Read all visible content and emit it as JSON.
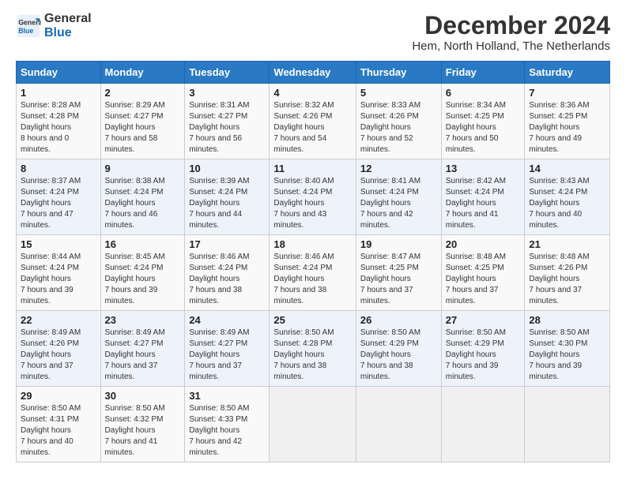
{
  "logo": {
    "line1": "General",
    "line2": "Blue"
  },
  "title": "December 2024",
  "subtitle": "Hem, North Holland, The Netherlands",
  "headers": [
    "Sunday",
    "Monday",
    "Tuesday",
    "Wednesday",
    "Thursday",
    "Friday",
    "Saturday"
  ],
  "weeks": [
    [
      {
        "day": "1",
        "sunrise": "8:28 AM",
        "sunset": "4:28 PM",
        "daylight": "8 hours and 0 minutes."
      },
      {
        "day": "2",
        "sunrise": "8:29 AM",
        "sunset": "4:27 PM",
        "daylight": "7 hours and 58 minutes."
      },
      {
        "day": "3",
        "sunrise": "8:31 AM",
        "sunset": "4:27 PM",
        "daylight": "7 hours and 56 minutes."
      },
      {
        "day": "4",
        "sunrise": "8:32 AM",
        "sunset": "4:26 PM",
        "daylight": "7 hours and 54 minutes."
      },
      {
        "day": "5",
        "sunrise": "8:33 AM",
        "sunset": "4:26 PM",
        "daylight": "7 hours and 52 minutes."
      },
      {
        "day": "6",
        "sunrise": "8:34 AM",
        "sunset": "4:25 PM",
        "daylight": "7 hours and 50 minutes."
      },
      {
        "day": "7",
        "sunrise": "8:36 AM",
        "sunset": "4:25 PM",
        "daylight": "7 hours and 49 minutes."
      }
    ],
    [
      {
        "day": "8",
        "sunrise": "8:37 AM",
        "sunset": "4:24 PM",
        "daylight": "7 hours and 47 minutes."
      },
      {
        "day": "9",
        "sunrise": "8:38 AM",
        "sunset": "4:24 PM",
        "daylight": "7 hours and 46 minutes."
      },
      {
        "day": "10",
        "sunrise": "8:39 AM",
        "sunset": "4:24 PM",
        "daylight": "7 hours and 44 minutes."
      },
      {
        "day": "11",
        "sunrise": "8:40 AM",
        "sunset": "4:24 PM",
        "daylight": "7 hours and 43 minutes."
      },
      {
        "day": "12",
        "sunrise": "8:41 AM",
        "sunset": "4:24 PM",
        "daylight": "7 hours and 42 minutes."
      },
      {
        "day": "13",
        "sunrise": "8:42 AM",
        "sunset": "4:24 PM",
        "daylight": "7 hours and 41 minutes."
      },
      {
        "day": "14",
        "sunrise": "8:43 AM",
        "sunset": "4:24 PM",
        "daylight": "7 hours and 40 minutes."
      }
    ],
    [
      {
        "day": "15",
        "sunrise": "8:44 AM",
        "sunset": "4:24 PM",
        "daylight": "7 hours and 39 minutes."
      },
      {
        "day": "16",
        "sunrise": "8:45 AM",
        "sunset": "4:24 PM",
        "daylight": "7 hours and 39 minutes."
      },
      {
        "day": "17",
        "sunrise": "8:46 AM",
        "sunset": "4:24 PM",
        "daylight": "7 hours and 38 minutes."
      },
      {
        "day": "18",
        "sunrise": "8:46 AM",
        "sunset": "4:24 PM",
        "daylight": "7 hours and 38 minutes."
      },
      {
        "day": "19",
        "sunrise": "8:47 AM",
        "sunset": "4:25 PM",
        "daylight": "7 hours and 37 minutes."
      },
      {
        "day": "20",
        "sunrise": "8:48 AM",
        "sunset": "4:25 PM",
        "daylight": "7 hours and 37 minutes."
      },
      {
        "day": "21",
        "sunrise": "8:48 AM",
        "sunset": "4:26 PM",
        "daylight": "7 hours and 37 minutes."
      }
    ],
    [
      {
        "day": "22",
        "sunrise": "8:49 AM",
        "sunset": "4:26 PM",
        "daylight": "7 hours and 37 minutes."
      },
      {
        "day": "23",
        "sunrise": "8:49 AM",
        "sunset": "4:27 PM",
        "daylight": "7 hours and 37 minutes."
      },
      {
        "day": "24",
        "sunrise": "8:49 AM",
        "sunset": "4:27 PM",
        "daylight": "7 hours and 37 minutes."
      },
      {
        "day": "25",
        "sunrise": "8:50 AM",
        "sunset": "4:28 PM",
        "daylight": "7 hours and 38 minutes."
      },
      {
        "day": "26",
        "sunrise": "8:50 AM",
        "sunset": "4:29 PM",
        "daylight": "7 hours and 38 minutes."
      },
      {
        "day": "27",
        "sunrise": "8:50 AM",
        "sunset": "4:29 PM",
        "daylight": "7 hours and 39 minutes."
      },
      {
        "day": "28",
        "sunrise": "8:50 AM",
        "sunset": "4:30 PM",
        "daylight": "7 hours and 39 minutes."
      }
    ],
    [
      {
        "day": "29",
        "sunrise": "8:50 AM",
        "sunset": "4:31 PM",
        "daylight": "7 hours and 40 minutes."
      },
      {
        "day": "30",
        "sunrise": "8:50 AM",
        "sunset": "4:32 PM",
        "daylight": "7 hours and 41 minutes."
      },
      {
        "day": "31",
        "sunrise": "8:50 AM",
        "sunset": "4:33 PM",
        "daylight": "7 hours and 42 minutes."
      },
      null,
      null,
      null,
      null
    ]
  ]
}
